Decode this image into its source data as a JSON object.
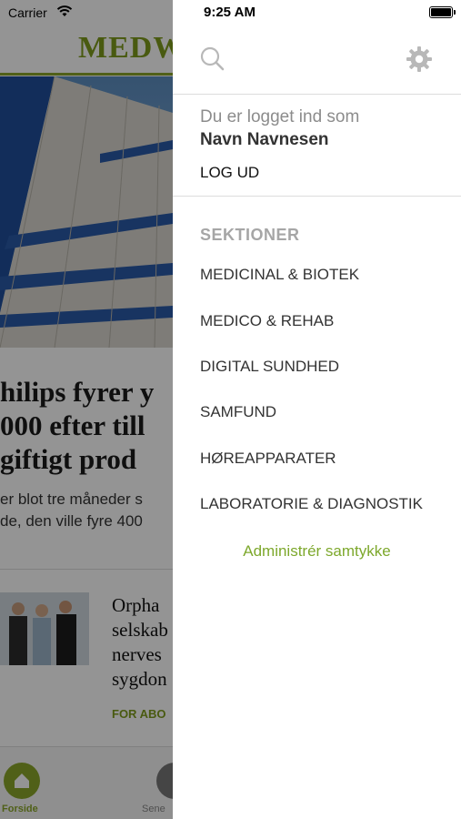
{
  "background_app": {
    "carrier": "Carrier",
    "logo": "MEDW",
    "headline_lines": [
      "hilips fyrer y",
      "000 efter till",
      " giftigt prod"
    ],
    "lead_lines": [
      "er blot tre måneder s",
      "de, den ville fyre 400"
    ],
    "article_lines": [
      "Orpha",
      "selskab",
      "nerves",
      "sygdon"
    ],
    "article_tag": "FOR ABO",
    "tab_home": "Forside",
    "tab_second": "Sene"
  },
  "status_bar": {
    "time": "9:25 AM"
  },
  "drawer": {
    "search_icon": "search-icon",
    "settings_icon": "gear-icon",
    "account": {
      "logged_in_label": "Du er logget ind som",
      "user_name": "Navn Navnesen",
      "logout_label": "LOG UD"
    },
    "sections_heading": "SEKTIONER",
    "sections": [
      "MEDICINAL & BIOTEK",
      "MEDICO & REHAB",
      "DIGITAL SUNDHED",
      "SAMFUND",
      "HØREAPPARATER",
      "LABORATORIE & DIAGNOSTIK"
    ],
    "consent_label": "Administrér samtykke"
  },
  "colors": {
    "accent_green": "#7da82c",
    "muted_gray": "#a6a6a6",
    "text_dark": "#333333"
  }
}
